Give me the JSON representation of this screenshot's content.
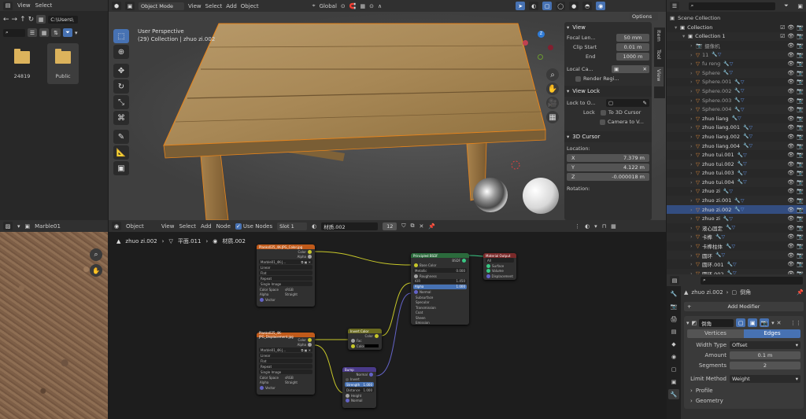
{
  "file_browser": {
    "menu": [
      "View",
      "Select"
    ],
    "path": "C:\\Users\\",
    "folders": [
      "24819",
      "Public"
    ]
  },
  "viewport": {
    "mode": "Object Mode",
    "menu": [
      "View",
      "Select",
      "Add",
      "Object"
    ],
    "orientation": "Global",
    "options_label": "Options",
    "perspective": "User Perspective",
    "collection_info": "(29) Collection | zhuo zi.002",
    "side_tabs": [
      "Item",
      "Tool",
      "View"
    ],
    "n_panel": {
      "view_header": "View",
      "focal_length_label": "Focal Len...",
      "focal_length": "50 mm",
      "clip_start_label": "Clip Start",
      "clip_start": "0.01 m",
      "end_label": "End",
      "end": "1000 m",
      "local_camera_label": "Local Ca...",
      "render_region_label": "Render Regi...",
      "view_lock_header": "View Lock",
      "lock_to_object_label": "Lock to O...",
      "lock_label": "Lock",
      "to_3d_cursor": "To 3D Cursor",
      "camera_to_view": "Camera to V...",
      "cursor_header": "3D Cursor",
      "location_label": "Location:",
      "x_label": "X",
      "x": "7.379 m",
      "y_label": "Y",
      "y": "4.122 m",
      "z_label": "Z",
      "z": "-0.000018 m",
      "rotation_label": "Rotation:"
    },
    "gizmo": {
      "x": "X",
      "y": "Y",
      "z": "Z"
    }
  },
  "image_editor": {
    "name": "Marble01"
  },
  "node_editor": {
    "mode": "Object",
    "menu": [
      "View",
      "Select",
      "Add",
      "Node"
    ],
    "use_nodes_label": "Use Nodes",
    "slot": "Slot 1",
    "material": "材质.002",
    "user_count": "12",
    "breadcrumb": [
      "zhuo zi.002",
      "平面.011",
      "材质.002"
    ],
    "tex1": {
      "title": "Planks025_4K-JPG_Color.jpg",
      "out": [
        "Color",
        "Alpha"
      ],
      "image": "Marble01_4K-J...",
      "opts": [
        "Linear",
        "Flat",
        "Repeat",
        "Single Image"
      ],
      "colorspace_label": "Color Space",
      "colorspace": "sRGB",
      "alpha_label": "Alpha",
      "alpha": "Straight",
      "vector": "Vector"
    },
    "tex2": {
      "title": "Planks025_4K-JPG_Displacement.jpg",
      "out": [
        "Color",
        "Alpha"
      ],
      "image": "Marble01_4K-J...",
      "opts": [
        "Linear",
        "Flat",
        "Repeat",
        "Single Image"
      ],
      "colorspace_label": "Color Space",
      "colorspace": "sRGB",
      "alpha_label": "Alpha",
      "alpha": "Straight",
      "vector": "Vector"
    },
    "bsdf": {
      "title": "Principled BSDF",
      "out": "BSDF",
      "rows": [
        "Base Color",
        "Metallic",
        "Roughness",
        "IOR",
        "Alpha",
        "Normal",
        "Subsurface",
        "Specular",
        "Transmission",
        "Coat",
        "Sheen",
        "Emission"
      ],
      "metallic": "0.000",
      "ior": "1.450",
      "alpha": "1.000"
    },
    "output": {
      "title": "Material Output",
      "target": "All",
      "rows": [
        "Surface",
        "Volume",
        "Displacement"
      ]
    },
    "invert": {
      "title": "Invert Color",
      "out": "Color",
      "rows": [
        "Fac",
        "Color"
      ]
    },
    "bump": {
      "title": "Bump",
      "out": "Normal",
      "invert_label": "Invert",
      "strength_label": "Strength",
      "strength": "1.000",
      "distance_label": "Distance",
      "distance": "1.000",
      "rows": [
        "Height",
        "Normal"
      ]
    }
  },
  "outliner": {
    "header": "Scene Collection",
    "items": [
      {
        "name": "Collection",
        "level": 0,
        "type": "collection"
      },
      {
        "name": "Collection 1",
        "level": 1,
        "type": "collection"
      },
      {
        "name": "摄像机",
        "level": 2,
        "type": "camera"
      },
      {
        "name": "11",
        "level": 2,
        "type": "mesh"
      },
      {
        "name": "fu reng",
        "level": 2,
        "type": "mesh"
      },
      {
        "name": "Sphere",
        "level": 2,
        "type": "mesh"
      },
      {
        "name": "Sphere.001",
        "level": 2,
        "type": "mesh"
      },
      {
        "name": "Sphere.002",
        "level": 2,
        "type": "mesh"
      },
      {
        "name": "Sphere.003",
        "level": 2,
        "type": "mesh"
      },
      {
        "name": "Sphere.004",
        "level": 2,
        "type": "mesh"
      },
      {
        "name": "zhuo liang",
        "level": 2,
        "type": "mesh"
      },
      {
        "name": "zhuo liang.001",
        "level": 2,
        "type": "mesh"
      },
      {
        "name": "zhuo liang.002",
        "level": 2,
        "type": "mesh"
      },
      {
        "name": "zhuo liang.004",
        "level": 2,
        "type": "mesh"
      },
      {
        "name": "zhuo tui.001",
        "level": 2,
        "type": "mesh"
      },
      {
        "name": "zhuo tui.002",
        "level": 2,
        "type": "mesh"
      },
      {
        "name": "zhuo tui.003",
        "level": 2,
        "type": "mesh"
      },
      {
        "name": "zhuo tui.004",
        "level": 2,
        "type": "mesh"
      },
      {
        "name": "zhuo zi",
        "level": 2,
        "type": "mesh"
      },
      {
        "name": "zhuo zi.001",
        "level": 2,
        "type": "mesh"
      },
      {
        "name": "zhuo zi.002",
        "level": 2,
        "type": "mesh",
        "selected": true
      },
      {
        "name": "zhuo zi",
        "level": 2,
        "type": "mesh"
      },
      {
        "name": "液心固定",
        "level": 2,
        "type": "mesh"
      },
      {
        "name": "卡榫",
        "level": 2,
        "type": "mesh"
      },
      {
        "name": "卡榫柱体",
        "level": 2,
        "type": "mesh"
      },
      {
        "name": "圆环",
        "level": 2,
        "type": "mesh"
      },
      {
        "name": "圆环.001",
        "level": 2,
        "type": "mesh"
      },
      {
        "name": "圆环.002",
        "level": 2,
        "type": "mesh"
      }
    ]
  },
  "properties": {
    "object_name": "zhuo zi.002",
    "modifier_path": "倒角",
    "add_modifier": "Add Modifier",
    "modifier_name": "倒角",
    "tabs": [
      "Vertices",
      "Edges"
    ],
    "active_tab": "Edges",
    "width_type_label": "Width Type",
    "width_type": "Offset",
    "amount_label": "Amount",
    "amount": "0.1 m",
    "segments_label": "Segments",
    "segments": "2",
    "limit_method_label": "Limit Method",
    "limit_method": "Weight",
    "profile_label": "Profile",
    "geometry_label": "Geometry"
  },
  "colors": {
    "accent": "#4772b3",
    "selected_row": "#334d80",
    "header": "#303030",
    "node_image": "#c05a1a",
    "node_shader": "#2b6b3c",
    "node_output": "#7a2a2a",
    "node_color": "#6b6b20",
    "node_vector": "#4a3a8a"
  }
}
